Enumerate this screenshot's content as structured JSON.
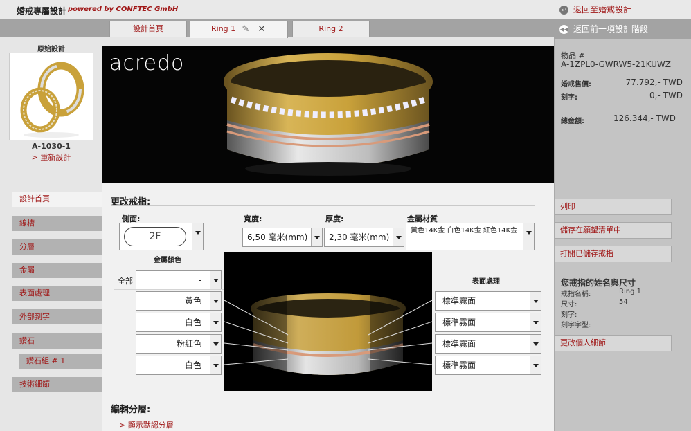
{
  "app": {
    "title": "婚戒專屬設計",
    "powered_by": "powered by CONFTEC GmbH"
  },
  "tabs": [
    {
      "label": "設計首頁"
    },
    {
      "label": "Ring 1",
      "edit_icon": "pencil-icon",
      "close_icon": "close-icon"
    },
    {
      "label": "Ring 2"
    }
  ],
  "original": {
    "label": "原始設計",
    "code": "A-1030-1",
    "redesign": "> 重新設計"
  },
  "hero": {
    "brand": "acredo"
  },
  "right_panel": {
    "back_to_design": "返回至婚戒設計",
    "back_step": "返回前一項設計階段",
    "item_label": "物品 #",
    "item_code": "A-1ZPL0-GWRW5-21KUWZ",
    "price_label": "婚戒售價:",
    "price_value": "77.792,- TWD",
    "engrave_label": "刻字:",
    "engrave_value": "0,- TWD",
    "total_label": "總金額:",
    "total_value": "126.344,- TWD",
    "buttons": [
      "列印",
      "儲存在願望清單中",
      "打開已儲存戒指"
    ],
    "owner_title": "您戒指的姓名與尺寸",
    "ring_name_label": "戒指名稱:",
    "ring_name_value": "Ring 1",
    "size_label": "尺寸:",
    "size_value": "54",
    "engrave_text_label": "刻字:",
    "font_label": "刻字字型:",
    "personal_btn": "更改個人細節"
  },
  "left_nav": [
    "設計首頁",
    "線槽",
    "分層",
    "金屬",
    "表面處理",
    "外部刻字",
    "鑽石",
    "鑽石組 # 1",
    "技術細節"
  ],
  "change_ring": {
    "title": "更改戒指:",
    "profile_label": "側面:",
    "profile_value": "2F",
    "width_label": "寬度:",
    "width_value": "6,50 毫米(mm)",
    "thickness_label": "厚度:",
    "thickness_value": "2,30 毫米(mm)",
    "material_label": "金屬材質",
    "material_value": "黃色14K金 白色14K金 紅色14K金",
    "metal_color_label": "金屬顏色",
    "all_label": "全部",
    "all_value": "-",
    "colors": [
      "黃色",
      "白色",
      "粉紅色",
      "白色"
    ],
    "surface_label": "表面處理",
    "surfaces": [
      "標準霧面",
      "標準霧面",
      "標準霧面",
      "標準霧面"
    ]
  },
  "edit_layers": {
    "title": "編輯分層:",
    "show_default": "> 顯示默認分層"
  },
  "colors": {
    "accent": "#a01818",
    "gold": "#c9a13a",
    "rose": "#d89a7a",
    "white_gold": "#cfcfcf"
  }
}
